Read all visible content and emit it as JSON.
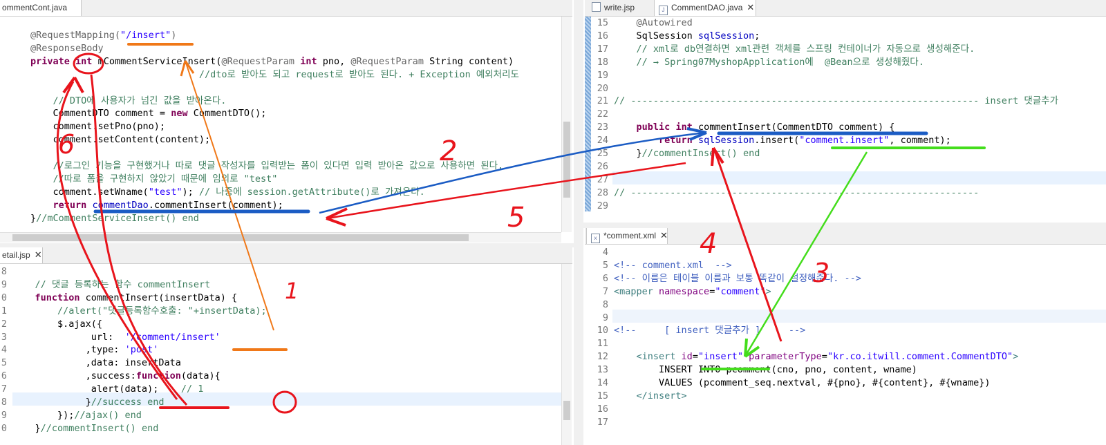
{
  "top_left_editor": {
    "tab_label": "ommentCont.java",
    "lines": [
      {
        "ln": "",
        "parts": [
          {
            "c": "an",
            "t": "@RequestMapping("
          },
          {
            "c": "str",
            "t": "\"/insert\""
          },
          {
            "c": "an",
            "t": ")"
          }
        ]
      },
      {
        "ln": "",
        "parts": [
          {
            "c": "an",
            "t": "@ResponseBody"
          }
        ]
      },
      {
        "ln": "",
        "parts": [
          {
            "c": "kw",
            "t": "private"
          },
          {
            "c": "",
            "t": " "
          },
          {
            "c": "kw",
            "t": "int"
          },
          {
            "c": "",
            "t": " mCommentServiceInsert("
          },
          {
            "c": "an",
            "t": "@RequestParam"
          },
          {
            "c": "",
            "t": " "
          },
          {
            "c": "kw",
            "t": "int"
          },
          {
            "c": "",
            "t": " pno, "
          },
          {
            "c": "an",
            "t": "@RequestParam"
          },
          {
            "c": "",
            "t": " String content)"
          }
        ]
      },
      {
        "ln": "",
        "parts": [
          {
            "c": "cm",
            "t": "                              //dto로 받아도 되고 request로 받아도 된다. + Exception 예외처리도"
          }
        ]
      },
      {
        "ln": "",
        "parts": [
          {
            "c": "",
            "t": ""
          }
        ]
      },
      {
        "ln": "",
        "parts": [
          {
            "c": "cm",
            "t": "    // DTO에 사용자가 넘긴 값을 받아온다."
          }
        ]
      },
      {
        "ln": "",
        "parts": [
          {
            "c": "",
            "t": "    CommentDTO comment = "
          },
          {
            "c": "kw",
            "t": "new"
          },
          {
            "c": "",
            "t": " CommentDTO();"
          }
        ]
      },
      {
        "ln": "",
        "parts": [
          {
            "c": "",
            "t": "    comment.setPno(pno);"
          }
        ]
      },
      {
        "ln": "",
        "parts": [
          {
            "c": "",
            "t": "    comment.setContent(content);"
          }
        ]
      },
      {
        "ln": "",
        "parts": [
          {
            "c": "",
            "t": ""
          }
        ]
      },
      {
        "ln": "",
        "parts": [
          {
            "c": "cm",
            "t": "    //로그인 기능을 구현했거나 따로 댓글 작성자를 입력받는 폼이 있다면 입력 받아온 값으로 사용하면 된다."
          }
        ]
      },
      {
        "ln": "",
        "parts": [
          {
            "c": "cm",
            "t": "    //따로 폼을 구현하지 않았기 때문에 임의로 \"test\""
          }
        ]
      },
      {
        "ln": "",
        "parts": [
          {
            "c": "",
            "t": "    comment.setWname("
          },
          {
            "c": "str",
            "t": "\"test\""
          },
          {
            "c": "",
            "t": "); "
          },
          {
            "c": "cm",
            "t": "// 나중에 session.getAttribute()로 가져온다."
          }
        ]
      },
      {
        "ln": "",
        "parts": [
          {
            "c": "",
            "t": "    "
          },
          {
            "c": "kw",
            "t": "return"
          },
          {
            "c": "",
            "t": " "
          },
          {
            "c": "fld",
            "t": "commentDao"
          },
          {
            "c": "",
            "t": ".commentInsert(comment);"
          }
        ]
      },
      {
        "ln": "",
        "parts": [
          {
            "c": "",
            "t": "}"
          },
          {
            "c": "cm",
            "t": "//mCommentServiceInsert() end"
          }
        ]
      }
    ]
  },
  "top_right_editor": {
    "tabs": [
      "write.jsp",
      "CommentDAO.java"
    ],
    "lines": [
      {
        "ln": "15",
        "parts": [
          {
            "c": "an",
            "t": "    @Autowired"
          }
        ]
      },
      {
        "ln": "16",
        "parts": [
          {
            "c": "",
            "t": "    SqlSession "
          },
          {
            "c": "fld",
            "t": "sqlSession"
          },
          {
            "c": "",
            "t": ";"
          }
        ]
      },
      {
        "ln": "17",
        "parts": [
          {
            "c": "cm",
            "t": "    // xml로 db연결하면 xml관련 객체를 스프링 컨테이너가 자동으로 생성해준다."
          }
        ]
      },
      {
        "ln": "18",
        "parts": [
          {
            "c": "cm",
            "t": "    // → Spring07MyshopApplication에  @Bean으로 생성해줬다."
          }
        ]
      },
      {
        "ln": "19",
        "parts": [
          {
            "c": "",
            "t": ""
          }
        ]
      },
      {
        "ln": "20",
        "parts": [
          {
            "c": "",
            "t": ""
          }
        ]
      },
      {
        "ln": "21",
        "parts": [
          {
            "c": "cm",
            "t": "// -------------------------------------------------------------- insert 댓글추가"
          }
        ]
      },
      {
        "ln": "22",
        "parts": [
          {
            "c": "",
            "t": ""
          }
        ]
      },
      {
        "ln": "23",
        "parts": [
          {
            "c": "",
            "t": "    "
          },
          {
            "c": "kw",
            "t": "public"
          },
          {
            "c": "",
            "t": " "
          },
          {
            "c": "kw",
            "t": "int"
          },
          {
            "c": "",
            "t": " commentInsert(CommentDTO comment) {"
          }
        ]
      },
      {
        "ln": "24",
        "parts": [
          {
            "c": "",
            "t": "        "
          },
          {
            "c": "kw",
            "t": "return"
          },
          {
            "c": "",
            "t": " "
          },
          {
            "c": "fld",
            "t": "sqlSession"
          },
          {
            "c": "",
            "t": ".insert("
          },
          {
            "c": "str",
            "t": "\"comment.insert\""
          },
          {
            "c": "",
            "t": ", comment);"
          }
        ]
      },
      {
        "ln": "25",
        "parts": [
          {
            "c": "",
            "t": "    }"
          },
          {
            "c": "cm",
            "t": "//commentInsert() end"
          }
        ]
      },
      {
        "ln": "26",
        "parts": [
          {
            "c": "",
            "t": ""
          }
        ]
      },
      {
        "ln": "27",
        "parts": [
          {
            "c": "",
            "t": ""
          }
        ]
      },
      {
        "ln": "28",
        "parts": [
          {
            "c": "cm",
            "t": "// --------------------------------------------------------------"
          }
        ]
      },
      {
        "ln": "29",
        "parts": [
          {
            "c": "",
            "t": ""
          }
        ]
      }
    ]
  },
  "bottom_left_editor": {
    "tab_label": "etail.jsp",
    "lines": [
      {
        "ln": "8",
        "parts": [
          {
            "c": "",
            "t": ""
          }
        ]
      },
      {
        "ln": "9",
        "parts": [
          {
            "c": "cm",
            "t": "    // 댓글 등록하는 함수 commentInsert"
          }
        ]
      },
      {
        "ln": "0",
        "parts": [
          {
            "c": "",
            "t": "    "
          },
          {
            "c": "kw",
            "t": "function"
          },
          {
            "c": "",
            "t": " commentInsert(insertData) {"
          }
        ]
      },
      {
        "ln": "1",
        "parts": [
          {
            "c": "cm",
            "t": "        //alert(\"댓글등록함수호출: \"+insertData);"
          }
        ]
      },
      {
        "ln": "2",
        "parts": [
          {
            "c": "",
            "t": "        $.ajax({"
          }
        ]
      },
      {
        "ln": "3",
        "parts": [
          {
            "c": "",
            "t": "              url:  "
          },
          {
            "c": "str",
            "t": "'/comment/insert'"
          }
        ]
      },
      {
        "ln": "4",
        "parts": [
          {
            "c": "",
            "t": "             ,type: "
          },
          {
            "c": "str",
            "t": "'post'"
          }
        ]
      },
      {
        "ln": "5",
        "parts": [
          {
            "c": "",
            "t": "             ,data: insertData"
          }
        ]
      },
      {
        "ln": "6",
        "parts": [
          {
            "c": "",
            "t": "             ,success:"
          },
          {
            "c": "kw",
            "t": "function"
          },
          {
            "c": "",
            "t": "(data){"
          }
        ]
      },
      {
        "ln": "7",
        "parts": [
          {
            "c": "",
            "t": "              alert(data);    "
          },
          {
            "c": "cm",
            "t": "// 1"
          }
        ]
      },
      {
        "ln": "8",
        "parts": [
          {
            "c": "",
            "t": "             }"
          },
          {
            "c": "cm",
            "t": "//success end"
          }
        ]
      },
      {
        "ln": "9",
        "parts": [
          {
            "c": "",
            "t": "        });"
          },
          {
            "c": "cm",
            "t": "//ajax() end"
          }
        ]
      },
      {
        "ln": "0",
        "parts": [
          {
            "c": "",
            "t": "    }"
          },
          {
            "c": "cm",
            "t": "//commentInsert() end"
          }
        ]
      }
    ]
  },
  "bottom_right_editor": {
    "tab_label": "*comment.xml",
    "lines": [
      {
        "ln": "4",
        "parts": [
          {
            "c": "",
            "t": ""
          }
        ]
      },
      {
        "ln": "5",
        "parts": [
          {
            "c": "xcm",
            "t": "<!-- comment.xml  -->"
          }
        ]
      },
      {
        "ln": "6",
        "parts": [
          {
            "c": "xcm",
            "t": "<!-- 이름은 테이블 이름과 보통 똑같이 설정해준다. -->"
          }
        ]
      },
      {
        "ln": "7",
        "parts": [
          {
            "c": "tag",
            "t": "<mapper "
          },
          {
            "c": "attr",
            "t": "namespace"
          },
          {
            "c": "",
            "t": "="
          },
          {
            "c": "str",
            "t": "\"comment\""
          },
          {
            "c": "tag",
            "t": ">"
          }
        ]
      },
      {
        "ln": "8",
        "parts": [
          {
            "c": "",
            "t": ""
          }
        ]
      },
      {
        "ln": "9",
        "parts": [
          {
            "c": "",
            "t": ""
          }
        ]
      },
      {
        "ln": "10",
        "parts": [
          {
            "c": "xcm",
            "t": "<!--     [ insert 댓글추가 ]     -->"
          }
        ]
      },
      {
        "ln": "11",
        "parts": [
          {
            "c": "",
            "t": ""
          }
        ]
      },
      {
        "ln": "12",
        "parts": [
          {
            "c": "tag",
            "t": "    <insert "
          },
          {
            "c": "attr",
            "t": "id"
          },
          {
            "c": "",
            "t": "="
          },
          {
            "c": "str",
            "t": "\"insert\""
          },
          {
            "c": "",
            "t": " "
          },
          {
            "c": "attr",
            "t": "parameterType"
          },
          {
            "c": "",
            "t": "="
          },
          {
            "c": "str",
            "t": "\"kr.co.itwill.comment.CommentDTO\""
          },
          {
            "c": "tag",
            "t": ">"
          }
        ]
      },
      {
        "ln": "13",
        "parts": [
          {
            "c": "",
            "t": "        INSERT INTO pcomment(cno, pno, content, wname)"
          }
        ]
      },
      {
        "ln": "14",
        "parts": [
          {
            "c": "",
            "t": "        VALUES (pcomment_seq.nextval, #{pno}, #{content}, #{wname})"
          }
        ]
      },
      {
        "ln": "15",
        "parts": [
          {
            "c": "tag",
            "t": "    </insert>"
          }
        ]
      },
      {
        "ln": "16",
        "parts": [
          {
            "c": "",
            "t": ""
          }
        ]
      },
      {
        "ln": "17",
        "parts": [
          {
            "c": "",
            "t": ""
          }
        ]
      }
    ]
  },
  "annotations": {
    "n1": "1",
    "n2": "2",
    "n3": "3",
    "n4": "4",
    "n5": "5",
    "n6": "6",
    "colors": {
      "red": "#e8141c",
      "blue": "#1b5cc4",
      "orange": "#f07818",
      "green": "#44dd1c"
    }
  }
}
